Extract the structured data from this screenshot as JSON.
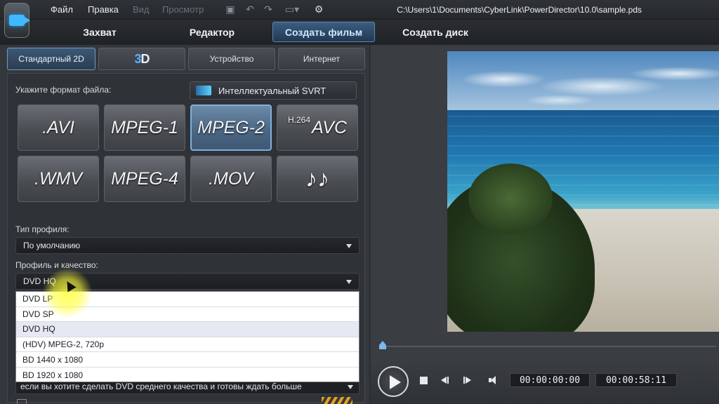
{
  "menu": {
    "items": [
      "Файл",
      "Правка",
      "Вид",
      "Просмотр"
    ],
    "project_path": "C:\\Users\\1\\Documents\\CyberLink\\PowerDirector\\10.0\\sample.pds"
  },
  "modes": [
    "Захват",
    "Редактор",
    "Создать фильм",
    "Создать диск"
  ],
  "active_mode": "Создать фильм",
  "subtabs": {
    "standard": "Стандартный 2D",
    "three_d_a": "3",
    "three_d_b": "D",
    "device": "Устройство",
    "internet": "Интернет"
  },
  "format_section": {
    "label": "Укажите формат файла:",
    "svrt_label": "Интеллектуальный SVRT",
    "formats": [
      ".AVI",
      "MPEG-1",
      "MPEG-2",
      "AVC",
      ".WMV",
      "MPEG-4",
      ".MOV",
      "♪♪"
    ],
    "h264_prefix": "H.264",
    "selected": "MPEG-2"
  },
  "profile_type": {
    "label": "Тип профиля:",
    "value": "По умолчанию"
  },
  "profile_quality": {
    "label": "Профиль и качество:",
    "value": "DVD HQ",
    "options": [
      "DVD LP",
      "DVD SP",
      "DVD HQ",
      "(HDV) MPEG-2, 720p",
      "BD 1440 x 1080",
      "BD 1920 x 1080"
    ]
  },
  "description_text": "если вы хотите сделать DVD среднего качества и готовы ждать больше",
  "player": {
    "current_time": "00:00:00:00",
    "total_time": "00:00:58:11"
  },
  "colors": {
    "accent": "#5a87b8",
    "highlight": "#ffff3c"
  }
}
